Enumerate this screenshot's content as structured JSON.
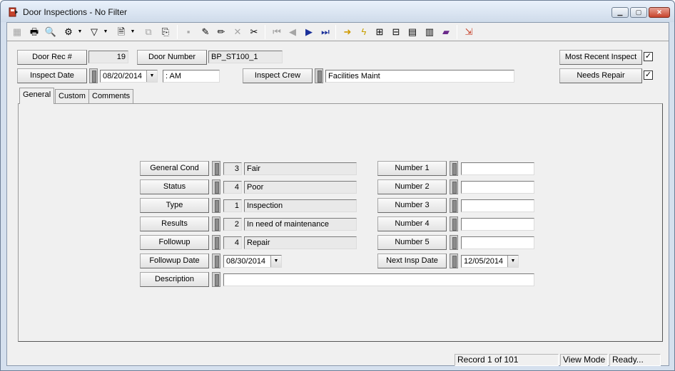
{
  "window": {
    "title": "Door Inspections - No Filter",
    "accent": "#c7442d"
  },
  "header": {
    "door_rec_label": "Door Rec #",
    "door_rec_value": "19",
    "door_number_label": "Door Number",
    "door_number_value": "BP_ST100_1",
    "inspect_date_label": "Inspect Date",
    "inspect_date_value": "08/20/2014",
    "inspect_time_value": " :  AM",
    "inspect_crew_label": "Inspect Crew",
    "inspect_crew_value": "Facilities Maint",
    "most_recent_label": "Most Recent Inspect",
    "most_recent_checked": "✓",
    "needs_repair_label": "Needs Repair",
    "needs_repair_checked": "✓"
  },
  "tabs": [
    "General",
    "Custom",
    "Comments"
  ],
  "general": {
    "left": [
      {
        "label": "General Cond",
        "code": "3",
        "value": "Fair"
      },
      {
        "label": "Status",
        "code": "4",
        "value": "Poor"
      },
      {
        "label": "Type",
        "code": "1",
        "value": "Inspection"
      },
      {
        "label": "Results",
        "code": "2",
        "value": "In need of maintenance"
      },
      {
        "label": "Followup",
        "code": "4",
        "value": "Repair"
      }
    ],
    "followup_date_label": "Followup Date",
    "followup_date_value": "08/30/2014",
    "description_label": "Description",
    "description_value": "",
    "right": [
      {
        "label": "Number 1",
        "value": ""
      },
      {
        "label": "Number 2",
        "value": ""
      },
      {
        "label": "Number 3",
        "value": ""
      },
      {
        "label": "Number 4",
        "value": ""
      },
      {
        "label": "Number 5",
        "value": ""
      }
    ],
    "next_insp_label": "Next Insp Date",
    "next_insp_value": "12/05/2014"
  },
  "status": {
    "record": "Record 1 of 101",
    "mode": "View Mode",
    "state": "Ready..."
  },
  "toolbar_icons": [
    "grid-icon",
    "print-icon",
    "print-preview-icon",
    "run-icon",
    "filter-icon",
    "report-icon",
    "export-icon",
    "copy-icon",
    "save-icon",
    "edit-icon",
    "pencil-icon",
    "delete-icon",
    "cut-icon",
    "first-record-icon",
    "prev-record-icon",
    "next-record-icon",
    "last-record-icon",
    "goto-icon",
    "lightning-icon",
    "map-icon",
    "tree-icon",
    "chart-icon",
    "calculator-icon",
    "book-icon",
    "exit-icon"
  ]
}
